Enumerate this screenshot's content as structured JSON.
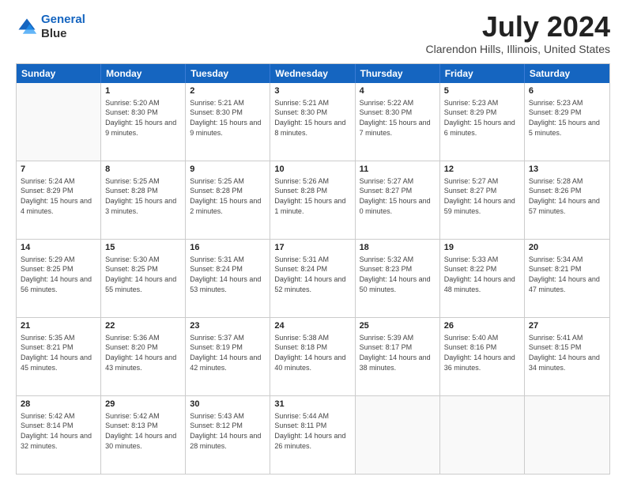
{
  "logo": {
    "line1": "General",
    "line2": "Blue"
  },
  "title": "July 2024",
  "location": "Clarendon Hills, Illinois, United States",
  "days_of_week": [
    "Sunday",
    "Monday",
    "Tuesday",
    "Wednesday",
    "Thursday",
    "Friday",
    "Saturday"
  ],
  "weeks": [
    [
      {
        "day": "",
        "sunrise": "",
        "sunset": "",
        "daylight": ""
      },
      {
        "day": "1",
        "sunrise": "Sunrise: 5:20 AM",
        "sunset": "Sunset: 8:30 PM",
        "daylight": "Daylight: 15 hours and 9 minutes."
      },
      {
        "day": "2",
        "sunrise": "Sunrise: 5:21 AM",
        "sunset": "Sunset: 8:30 PM",
        "daylight": "Daylight: 15 hours and 9 minutes."
      },
      {
        "day": "3",
        "sunrise": "Sunrise: 5:21 AM",
        "sunset": "Sunset: 8:30 PM",
        "daylight": "Daylight: 15 hours and 8 minutes."
      },
      {
        "day": "4",
        "sunrise": "Sunrise: 5:22 AM",
        "sunset": "Sunset: 8:30 PM",
        "daylight": "Daylight: 15 hours and 7 minutes."
      },
      {
        "day": "5",
        "sunrise": "Sunrise: 5:23 AM",
        "sunset": "Sunset: 8:29 PM",
        "daylight": "Daylight: 15 hours and 6 minutes."
      },
      {
        "day": "6",
        "sunrise": "Sunrise: 5:23 AM",
        "sunset": "Sunset: 8:29 PM",
        "daylight": "Daylight: 15 hours and 5 minutes."
      }
    ],
    [
      {
        "day": "7",
        "sunrise": "Sunrise: 5:24 AM",
        "sunset": "Sunset: 8:29 PM",
        "daylight": "Daylight: 15 hours and 4 minutes."
      },
      {
        "day": "8",
        "sunrise": "Sunrise: 5:25 AM",
        "sunset": "Sunset: 8:28 PM",
        "daylight": "Daylight: 15 hours and 3 minutes."
      },
      {
        "day": "9",
        "sunrise": "Sunrise: 5:25 AM",
        "sunset": "Sunset: 8:28 PM",
        "daylight": "Daylight: 15 hours and 2 minutes."
      },
      {
        "day": "10",
        "sunrise": "Sunrise: 5:26 AM",
        "sunset": "Sunset: 8:28 PM",
        "daylight": "Daylight: 15 hours and 1 minute."
      },
      {
        "day": "11",
        "sunrise": "Sunrise: 5:27 AM",
        "sunset": "Sunset: 8:27 PM",
        "daylight": "Daylight: 15 hours and 0 minutes."
      },
      {
        "day": "12",
        "sunrise": "Sunrise: 5:27 AM",
        "sunset": "Sunset: 8:27 PM",
        "daylight": "Daylight: 14 hours and 59 minutes."
      },
      {
        "day": "13",
        "sunrise": "Sunrise: 5:28 AM",
        "sunset": "Sunset: 8:26 PM",
        "daylight": "Daylight: 14 hours and 57 minutes."
      }
    ],
    [
      {
        "day": "14",
        "sunrise": "Sunrise: 5:29 AM",
        "sunset": "Sunset: 8:25 PM",
        "daylight": "Daylight: 14 hours and 56 minutes."
      },
      {
        "day": "15",
        "sunrise": "Sunrise: 5:30 AM",
        "sunset": "Sunset: 8:25 PM",
        "daylight": "Daylight: 14 hours and 55 minutes."
      },
      {
        "day": "16",
        "sunrise": "Sunrise: 5:31 AM",
        "sunset": "Sunset: 8:24 PM",
        "daylight": "Daylight: 14 hours and 53 minutes."
      },
      {
        "day": "17",
        "sunrise": "Sunrise: 5:31 AM",
        "sunset": "Sunset: 8:24 PM",
        "daylight": "Daylight: 14 hours and 52 minutes."
      },
      {
        "day": "18",
        "sunrise": "Sunrise: 5:32 AM",
        "sunset": "Sunset: 8:23 PM",
        "daylight": "Daylight: 14 hours and 50 minutes."
      },
      {
        "day": "19",
        "sunrise": "Sunrise: 5:33 AM",
        "sunset": "Sunset: 8:22 PM",
        "daylight": "Daylight: 14 hours and 48 minutes."
      },
      {
        "day": "20",
        "sunrise": "Sunrise: 5:34 AM",
        "sunset": "Sunset: 8:21 PM",
        "daylight": "Daylight: 14 hours and 47 minutes."
      }
    ],
    [
      {
        "day": "21",
        "sunrise": "Sunrise: 5:35 AM",
        "sunset": "Sunset: 8:21 PM",
        "daylight": "Daylight: 14 hours and 45 minutes."
      },
      {
        "day": "22",
        "sunrise": "Sunrise: 5:36 AM",
        "sunset": "Sunset: 8:20 PM",
        "daylight": "Daylight: 14 hours and 43 minutes."
      },
      {
        "day": "23",
        "sunrise": "Sunrise: 5:37 AM",
        "sunset": "Sunset: 8:19 PM",
        "daylight": "Daylight: 14 hours and 42 minutes."
      },
      {
        "day": "24",
        "sunrise": "Sunrise: 5:38 AM",
        "sunset": "Sunset: 8:18 PM",
        "daylight": "Daylight: 14 hours and 40 minutes."
      },
      {
        "day": "25",
        "sunrise": "Sunrise: 5:39 AM",
        "sunset": "Sunset: 8:17 PM",
        "daylight": "Daylight: 14 hours and 38 minutes."
      },
      {
        "day": "26",
        "sunrise": "Sunrise: 5:40 AM",
        "sunset": "Sunset: 8:16 PM",
        "daylight": "Daylight: 14 hours and 36 minutes."
      },
      {
        "day": "27",
        "sunrise": "Sunrise: 5:41 AM",
        "sunset": "Sunset: 8:15 PM",
        "daylight": "Daylight: 14 hours and 34 minutes."
      }
    ],
    [
      {
        "day": "28",
        "sunrise": "Sunrise: 5:42 AM",
        "sunset": "Sunset: 8:14 PM",
        "daylight": "Daylight: 14 hours and 32 minutes."
      },
      {
        "day": "29",
        "sunrise": "Sunrise: 5:42 AM",
        "sunset": "Sunset: 8:13 PM",
        "daylight": "Daylight: 14 hours and 30 minutes."
      },
      {
        "day": "30",
        "sunrise": "Sunrise: 5:43 AM",
        "sunset": "Sunset: 8:12 PM",
        "daylight": "Daylight: 14 hours and 28 minutes."
      },
      {
        "day": "31",
        "sunrise": "Sunrise: 5:44 AM",
        "sunset": "Sunset: 8:11 PM",
        "daylight": "Daylight: 14 hours and 26 minutes."
      },
      {
        "day": "",
        "sunrise": "",
        "sunset": "",
        "daylight": ""
      },
      {
        "day": "",
        "sunrise": "",
        "sunset": "",
        "daylight": ""
      },
      {
        "day": "",
        "sunrise": "",
        "sunset": "",
        "daylight": ""
      }
    ]
  ]
}
